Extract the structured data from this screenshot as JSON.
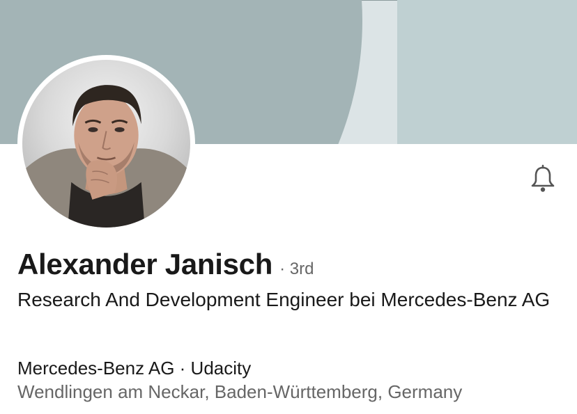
{
  "profile": {
    "name": "Alexander Janisch",
    "degree": "· 3rd",
    "headline": "Research And Development Engineer bei Mercedes-Benz AG",
    "companies": "Mercedes-Benz AG · Udacity",
    "location": "Wendlingen am Neckar, Baden-Württemberg, Germany"
  },
  "icons": {
    "notification": "bell-icon"
  },
  "colors": {
    "cover_arc": "#a3b4b6",
    "cover_background": "#dce4e6",
    "cover_panel": "#bfd0d2",
    "primary_text": "#191919",
    "secondary_text": "#666666"
  }
}
